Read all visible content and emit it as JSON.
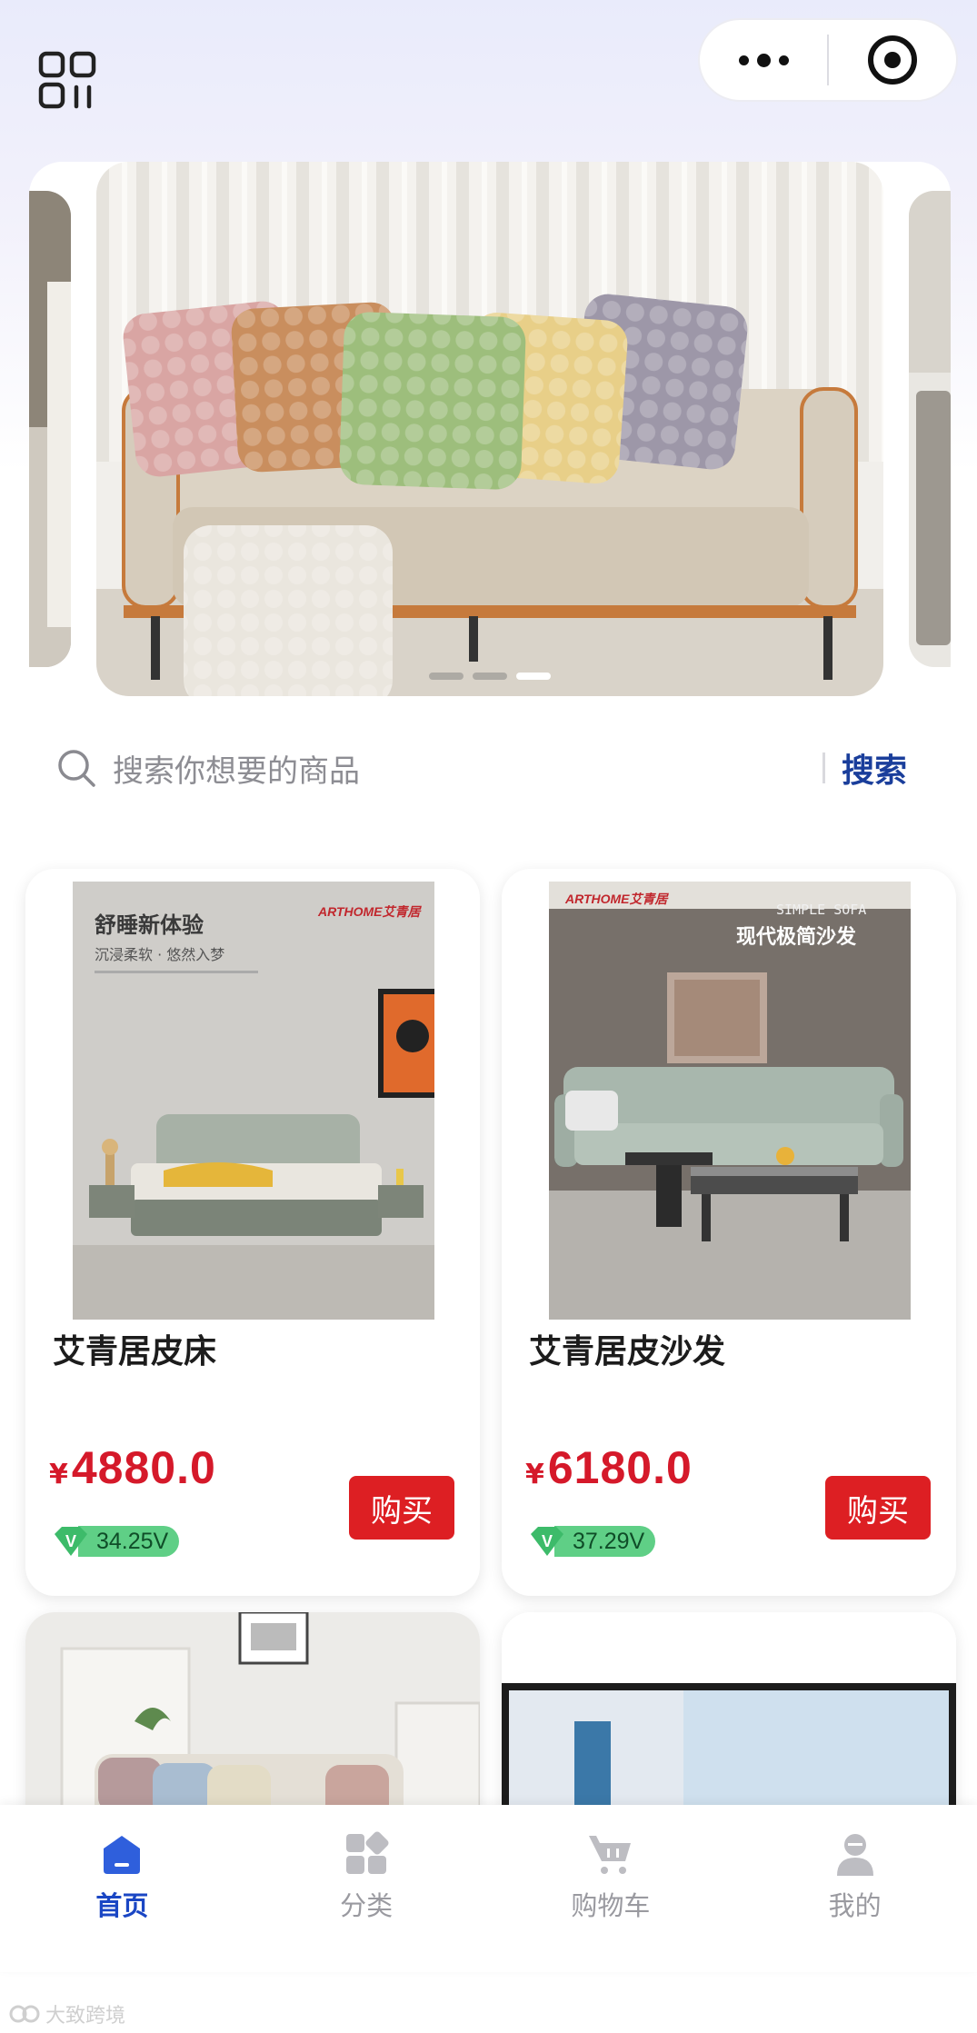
{
  "header": {
    "menu_icon": "grid-apps-icon",
    "capsule": {
      "more_icon": "more-dots-icon",
      "close_icon": "target-circle-icon"
    }
  },
  "banner": {
    "slides": [
      "pillows-on-sofa",
      "living-room-left",
      "living-room-right"
    ],
    "active_slide_index": 2,
    "slide_count": 3
  },
  "search": {
    "placeholder": "搜索你想要的商品",
    "button_label": "搜索",
    "icon": "search-icon"
  },
  "products": [
    {
      "name": "艾青居皮床",
      "currency": "¥",
      "price": "4880.0",
      "vip_value": "34.25V",
      "buy_label": "购买",
      "image": {
        "brand": "ARTHOME艾青居",
        "headline": "舒睡新体验",
        "subline": "沉浸柔软 · 悠然入梦"
      }
    },
    {
      "name": "艾青居皮沙发",
      "currency": "¥",
      "price": "6180.0",
      "vip_value": "37.29V",
      "buy_label": "购买",
      "image": {
        "brand": "ARTHOME艾青居",
        "headline": "现代极简沙发",
        "subline": "SIMPLE SOFA"
      }
    }
  ],
  "tabbar": {
    "items": [
      {
        "label": "首页",
        "icon": "home-icon",
        "active": true
      },
      {
        "label": "分类",
        "icon": "category-icon",
        "active": false
      },
      {
        "label": "购物车",
        "icon": "cart-icon",
        "active": false
      },
      {
        "label": "我的",
        "icon": "profile-icon",
        "active": false
      }
    ]
  },
  "watermark": {
    "text": "大致跨境",
    "icon": "watermark-logo-icon"
  },
  "colors": {
    "accent": "#1a46c4",
    "price": "#d5192a",
    "buy": "#dd1f23",
    "vip": "#5fcf86",
    "search_btn": "#1a3e9b"
  }
}
